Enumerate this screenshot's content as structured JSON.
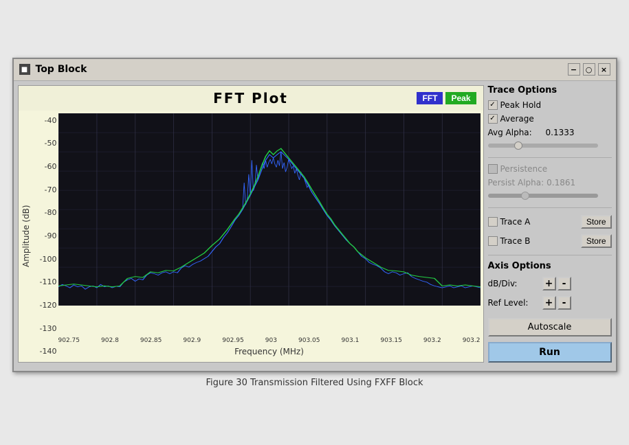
{
  "titlebar": {
    "title": "Top Block",
    "icon": "■",
    "btn_minimize": "−",
    "btn_maximize": "○",
    "btn_close": "×"
  },
  "plot": {
    "title": "FFT  Plot",
    "btn_fft": "FFT",
    "btn_peak": "Peak",
    "y_axis_label": "Amplitude (dB)",
    "x_axis_label": "Frequency (MHz)",
    "y_ticks": [
      "-40",
      "-50",
      "-60",
      "-70",
      "-80",
      "-90",
      "-100",
      "-110",
      "-120",
      "-130",
      "-140"
    ],
    "x_ticks": [
      "902.75",
      "902.8",
      "902.85",
      "902.9",
      "902.95",
      "903",
      "903.05",
      "903.1",
      "903.15",
      "903.2",
      "903.2"
    ]
  },
  "trace_options": {
    "section_label": "Trace  Options",
    "peak_hold_label": "Peak Hold",
    "peak_hold_checked": true,
    "average_label": "Average",
    "average_checked": true,
    "avg_alpha_label": "Avg Alpha:",
    "avg_alpha_value": "0.1333",
    "avg_alpha_slider_pos": 40,
    "persistence_label": "Persistence",
    "persistence_checked": false,
    "persist_alpha_label": "Persist Alpha:",
    "persist_alpha_value": "0.1861",
    "persist_alpha_slider_pos": 50,
    "trace_a_label": "Trace A",
    "trace_b_label": "Trace B",
    "store_label": "Store"
  },
  "axis_options": {
    "section_label": "Axis  Options",
    "db_div_label": "dB/Div:",
    "ref_level_label": "Ref Level:",
    "plus": "+",
    "minus": "-"
  },
  "buttons": {
    "autoscale": "Autoscale",
    "run": "Run"
  },
  "caption": "Figure 30  Transmission Filtered Using FXFF Block"
}
